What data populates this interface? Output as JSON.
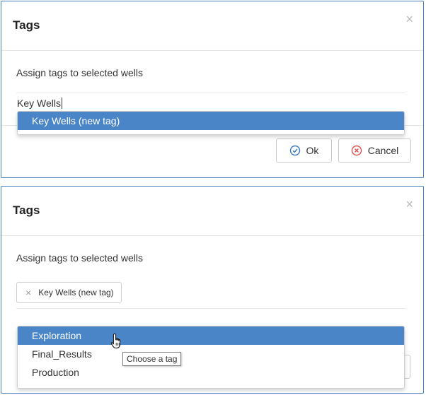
{
  "dialog_top": {
    "title": "Tags",
    "close_glyph": "×",
    "assign_label": "Assign tags to selected wells",
    "input_value": "Key Wells",
    "dropdown_items": [
      "Key Wells (new tag)"
    ],
    "ok_label": "Ok",
    "cancel_label": "Cancel"
  },
  "dialog_bottom": {
    "title": "Tags",
    "close_glyph": "×",
    "assign_label": "Assign tags to selected wells",
    "chip_remove_glyph": "×",
    "chip_label": "Key Wells (new tag)",
    "dropdown_items": [
      "Exploration",
      "Final_Results",
      "Production"
    ],
    "tooltip": "Choose a tag"
  },
  "icons": {
    "ok": "check-circle-icon",
    "cancel": "x-circle-icon",
    "cursor": "hand-pointer-icon"
  },
  "colors": {
    "accent": "#4a86c7",
    "dialog_border": "#3f7fbf",
    "ok_icon": "#3a7bbf",
    "cancel_icon": "#d9534f"
  }
}
